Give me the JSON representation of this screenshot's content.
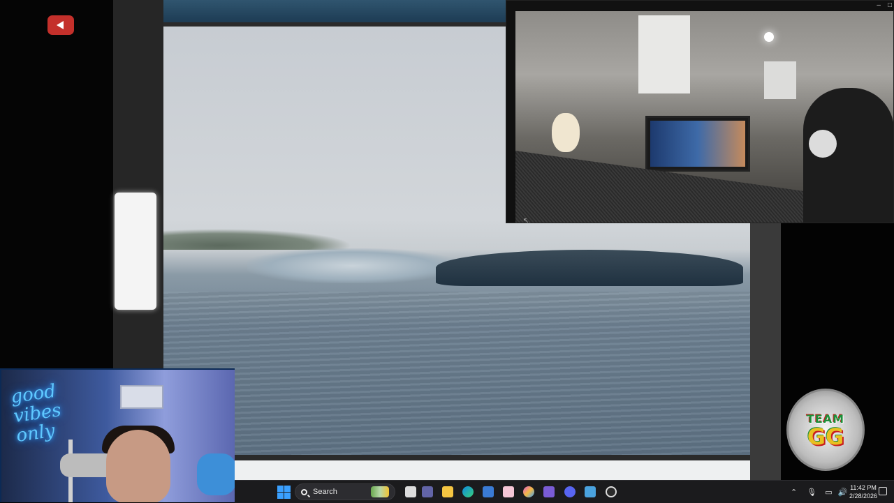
{
  "taskbar": {
    "search_placeholder": "Search",
    "clock_time": "11:42 PM",
    "clock_date": "2/28/2026",
    "apps": [
      "widgets-icon",
      "task-view-icon",
      "teams-icon",
      "file-explorer-icon",
      "edge-icon",
      "store-icon",
      "pinned-app-icon",
      "copilot-icon",
      "devtools-icon",
      "discord-icon",
      "notepad-icon",
      "obs-icon"
    ]
  },
  "overlay": {
    "badge_top": "TEAM",
    "badge_main": "GG",
    "neon_text_line1": "good",
    "neon_text_line2": "vibes",
    "neon_text_line3": "only"
  },
  "cam_window": {
    "minimize": "–",
    "maximize": "□"
  },
  "colors": {
    "youtube_red": "#c4302b",
    "taskbar_bg": "#1b1b1d",
    "start_blue": "#3aa0ff"
  }
}
